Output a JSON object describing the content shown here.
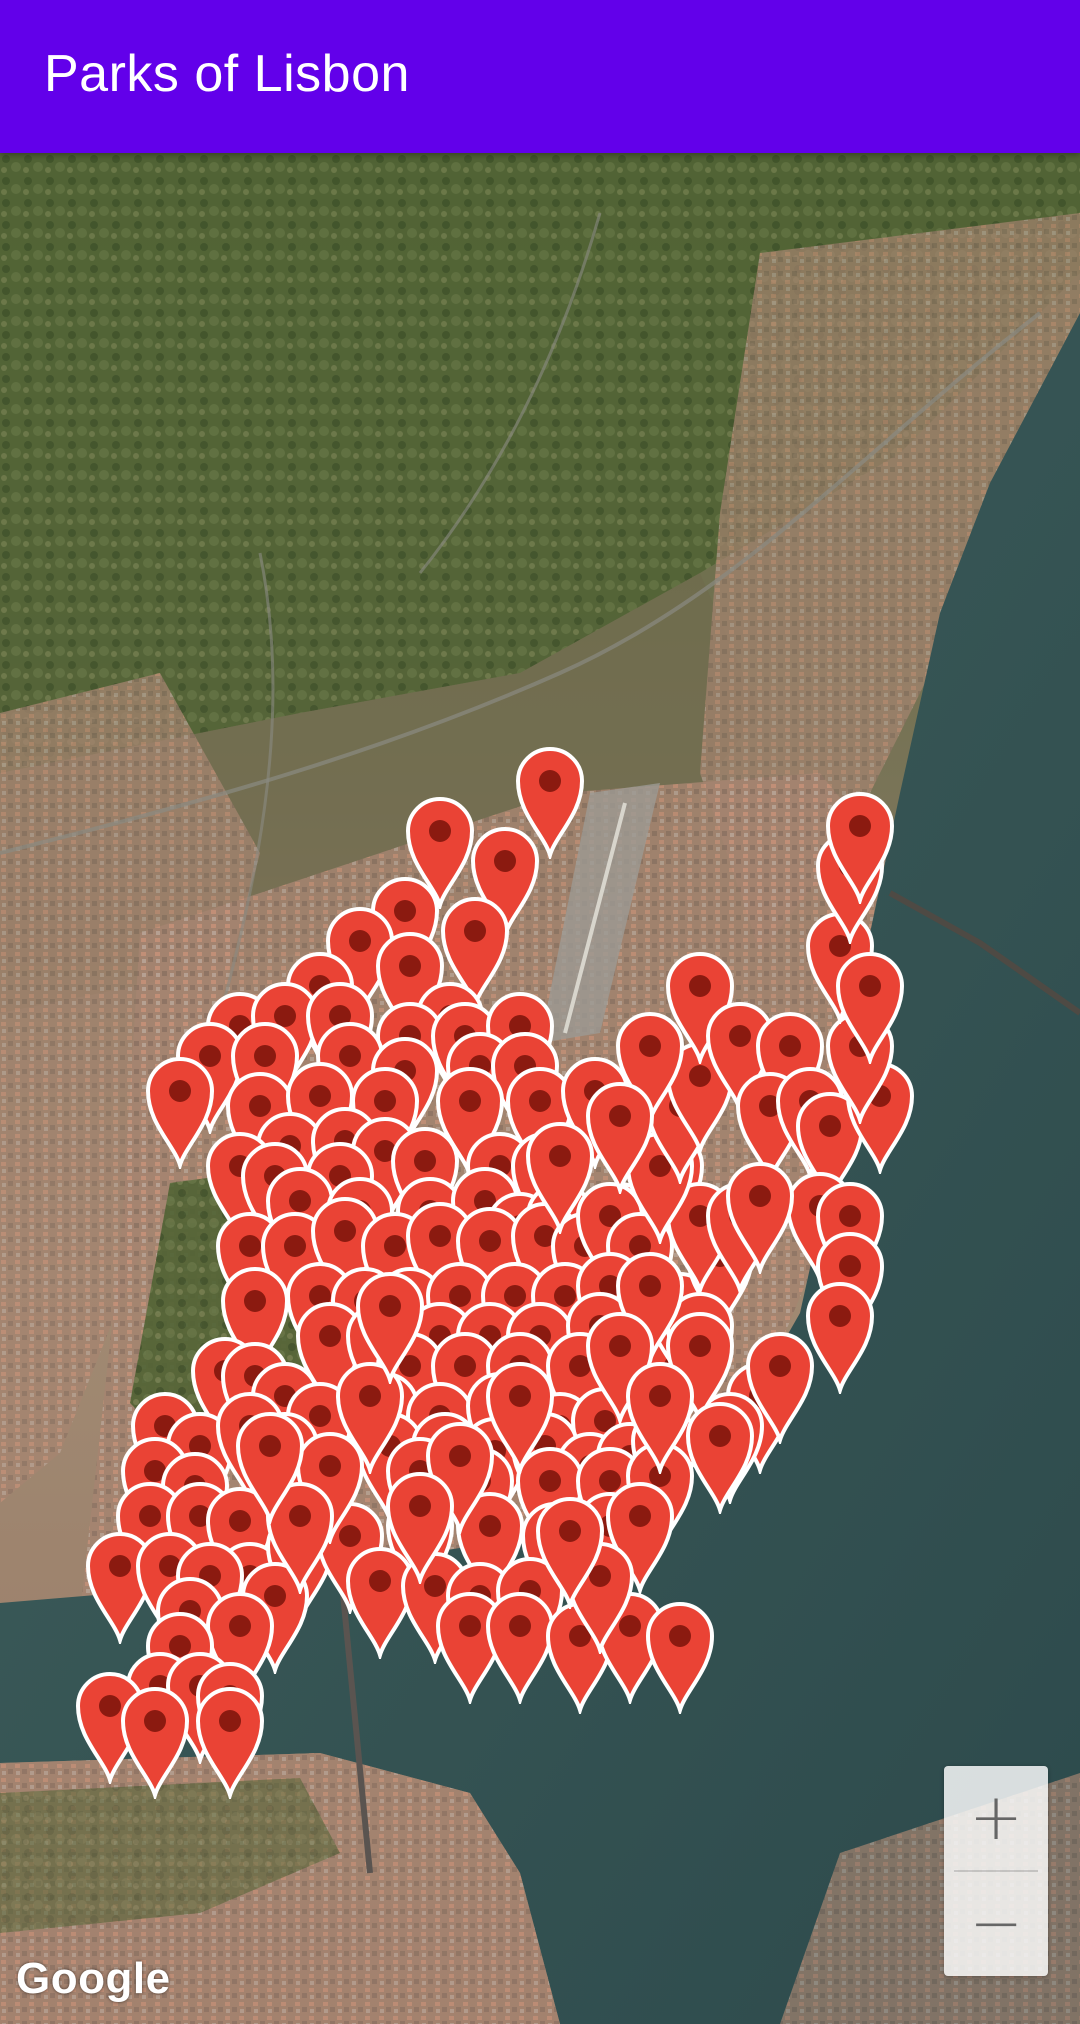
{
  "app_bar": {
    "title": "Parks of Lisbon",
    "color": "#6200ea"
  },
  "map": {
    "type": "satellite",
    "attribution": "Google",
    "marker_color": "#ea4335",
    "marker_dot_color": "#8b1a10",
    "marker_icon": "map-pin-icon",
    "zoom_controls": {
      "zoom_in_label": "+",
      "zoom_out_label": "−"
    }
  }
}
